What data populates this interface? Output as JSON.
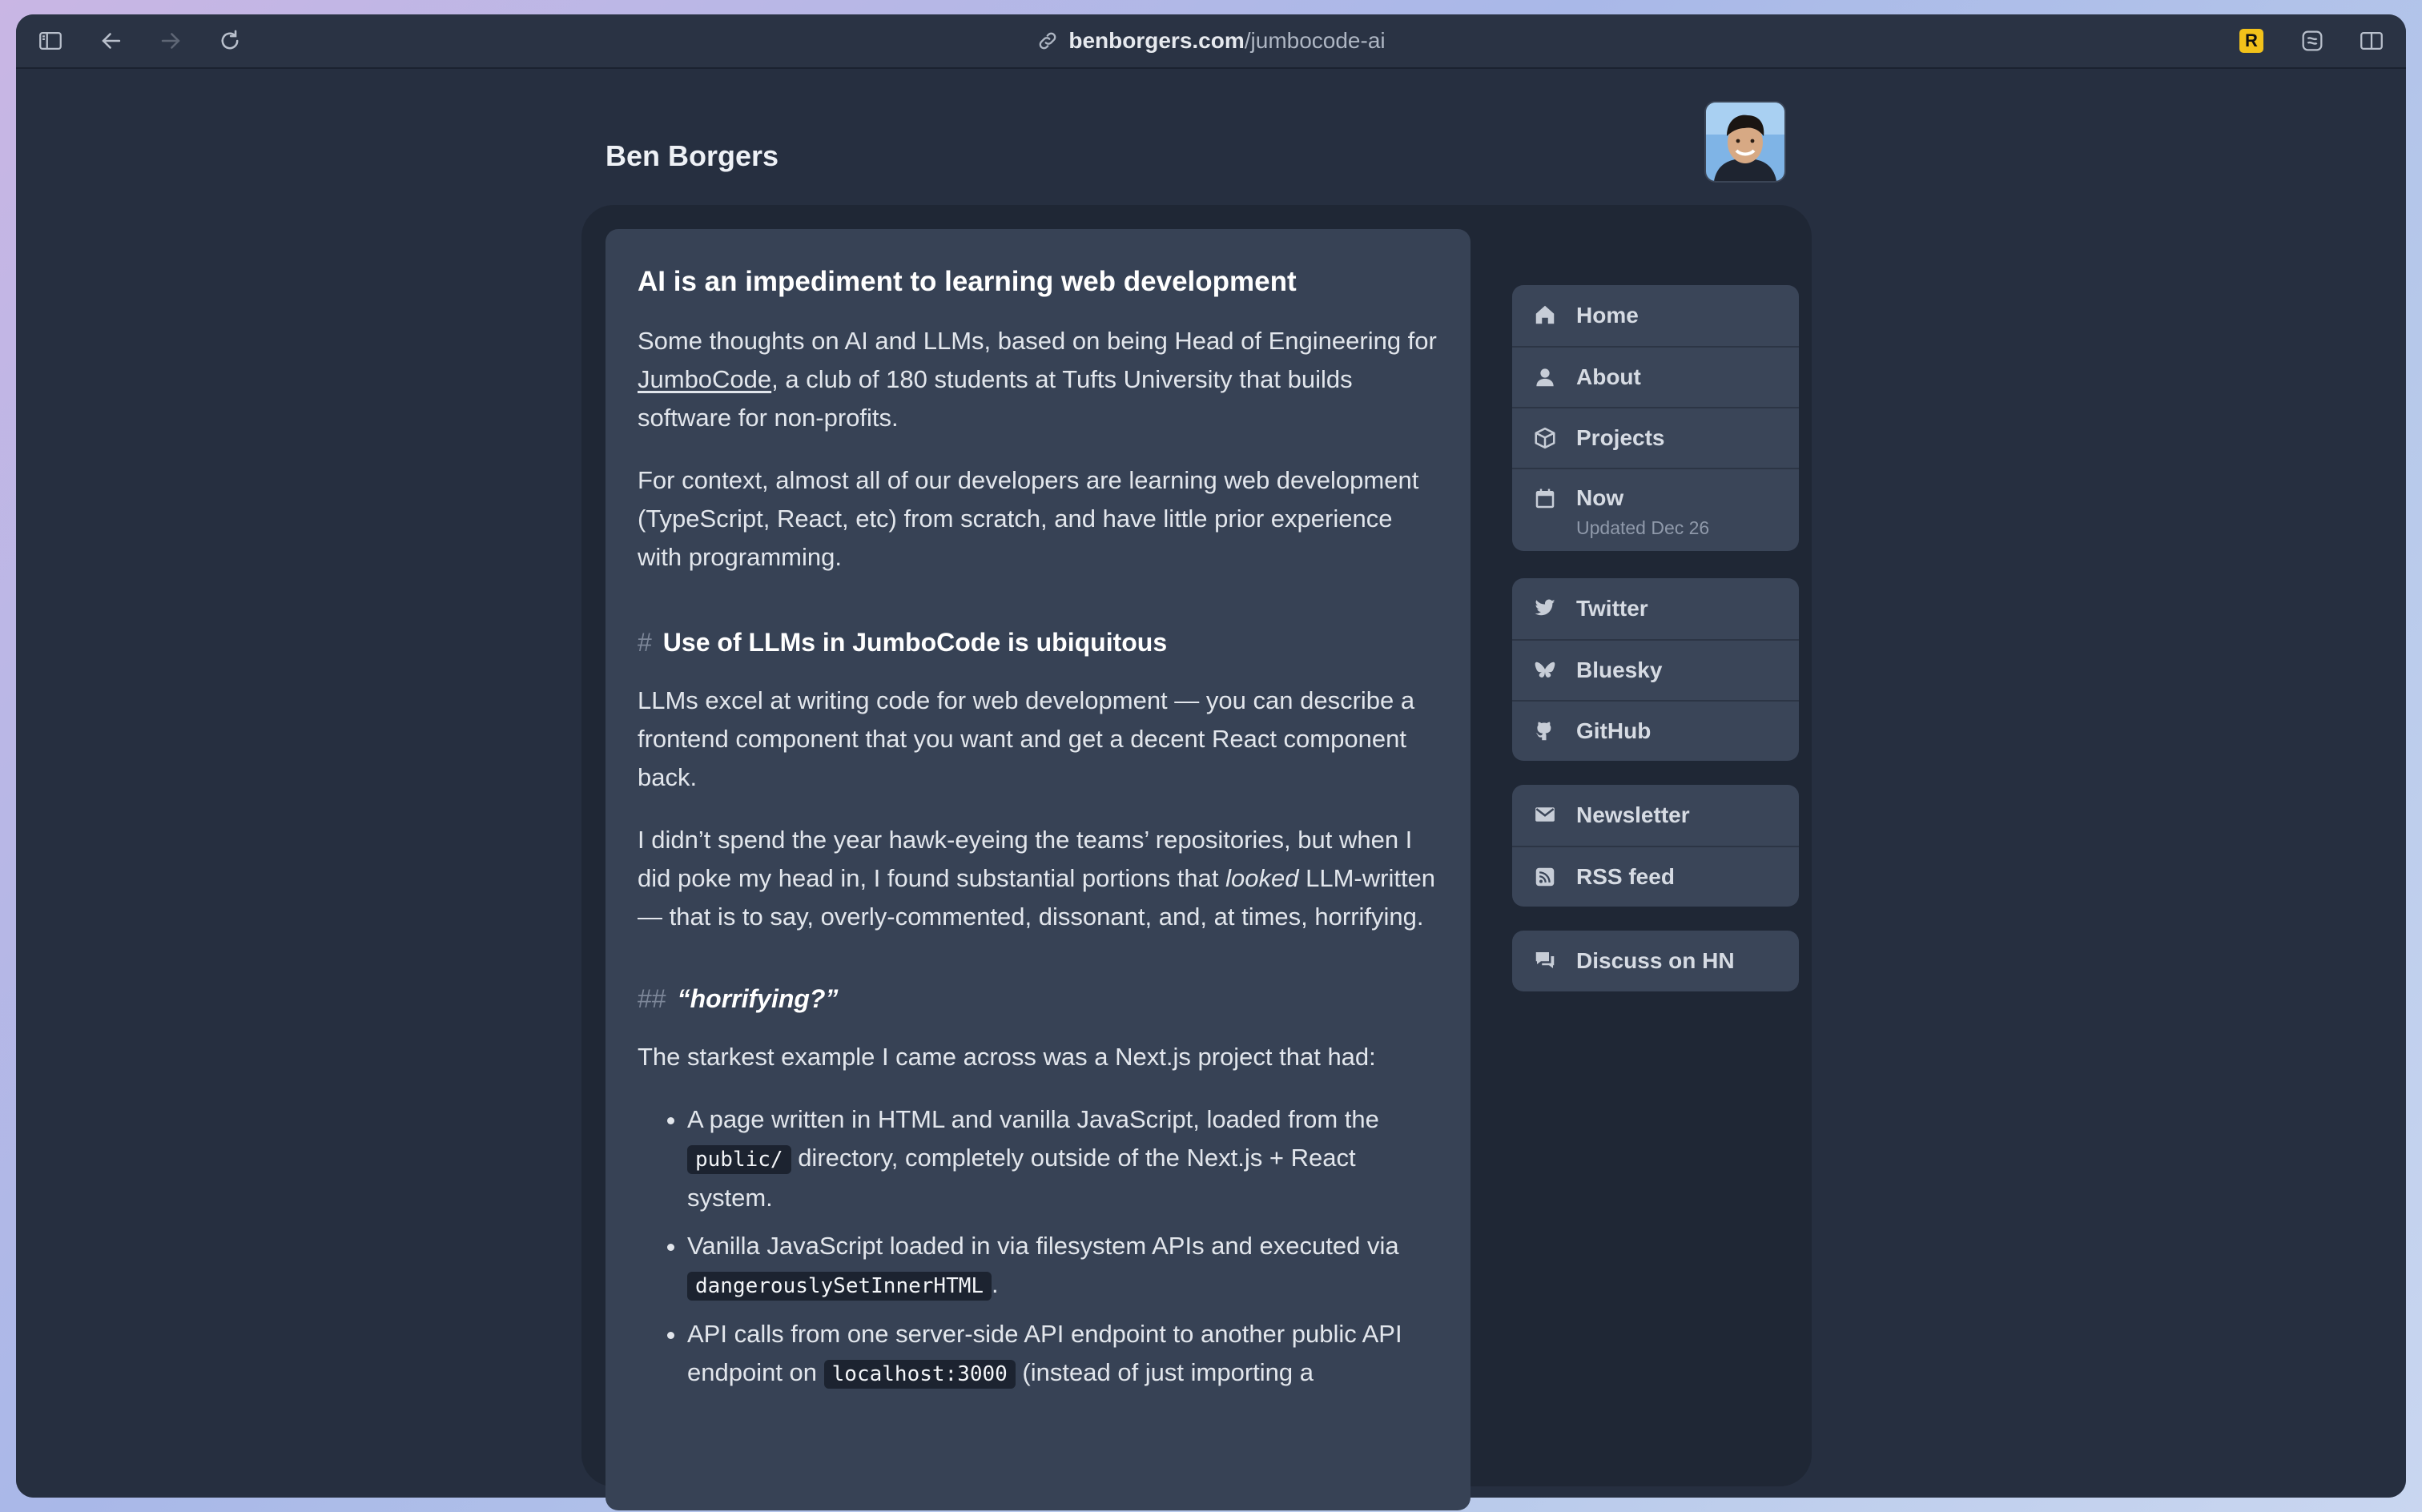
{
  "browser": {
    "url_domain": "benborgers.com",
    "url_path": "/jumbocode-ai",
    "reader_badge": "R"
  },
  "site": {
    "title": "Ben Borgers"
  },
  "article": {
    "title": "AI is an impediment to learning web development",
    "p1_a": "Some thoughts on AI and LLMs, based on being Head of Engineering for ",
    "p1_link": "JumboCode",
    "p1_b": ", a club of 180 students at Tufts University that builds software for non-profits.",
    "p2": "For context, almost all of our developers are learning web development (TypeScript, React, etc) from scratch, and have little prior experience with programming.",
    "h2_hash": "#",
    "h2": "Use of LLMs in JumboCode is ubiquitous",
    "p3": "LLMs excel at writing code for web development — you can describe a frontend component that you want and get a decent React component back.",
    "p4_a": "I didn’t spend the year hawk-eyeing the teams’ repositories, but when I did poke my head in, I found substantial portions that ",
    "p4_em": "looked",
    "p4_b": " LLM-written — that is to say, overly-commented, dissonant, and, at times, horrifying.",
    "h3_hash": "##",
    "h3": "“horrifying?”",
    "p5": "The starkest example I came across was a Next.js project that had:",
    "li1_a": "A page written in HTML and vanilla JavaScript, loaded from the ",
    "li1_code": "public/",
    "li1_b": " directory, completely outside of the Next.js + React system.",
    "li2_a": "Vanilla JavaScript loaded in via filesystem APIs and executed via ",
    "li2_code": "dangerouslySetInnerHTML",
    "li2_b": ".",
    "li3_a": "API calls from one server-side API endpoint to another public API endpoint on ",
    "li3_code": "localhost:3000",
    "li3_b": " (instead of just importing a"
  },
  "nav": {
    "main": [
      {
        "label": "Home",
        "icon": "home-icon"
      },
      {
        "label": "About",
        "icon": "person-icon"
      },
      {
        "label": "Projects",
        "icon": "cube-icon"
      },
      {
        "label": "Now",
        "sub": "Updated Dec 26",
        "icon": "calendar-icon"
      }
    ],
    "social": [
      {
        "label": "Twitter",
        "icon": "twitter-icon"
      },
      {
        "label": "Bluesky",
        "icon": "butterfly-icon"
      },
      {
        "label": "GitHub",
        "icon": "github-icon"
      }
    ],
    "subscribe": [
      {
        "label": "Newsletter",
        "icon": "mail-icon"
      },
      {
        "label": "RSS feed",
        "icon": "rss-icon"
      }
    ],
    "discuss": [
      {
        "label": "Discuss on HN",
        "icon": "chat-icon"
      }
    ]
  }
}
